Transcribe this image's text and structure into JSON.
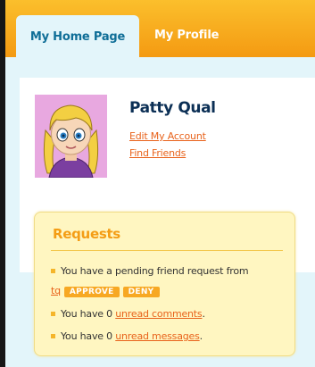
{
  "tabs": [
    {
      "label": "My Home Page",
      "active": true
    },
    {
      "label": "My Profile",
      "active": false
    }
  ],
  "user": {
    "name": "Patty Qual",
    "edit_account": "Edit My Account",
    "find_friends": "Find Friends"
  },
  "requests": {
    "title": "Requests",
    "friend_request_text": "You have a pending friend request from",
    "friend_name": "tq",
    "approve_label": "APPROVE",
    "deny_label": "DENY",
    "comments_prefix": "You have 0",
    "comments_link": "unread comments",
    "messages_prefix": "You have 0",
    "messages_link": "unread messages",
    "period": "."
  },
  "colors": {
    "tab_gradient_top": "#fbbf2c",
    "tab_gradient_bottom": "#f49a12",
    "active_tab_text": "#0f6e97",
    "link": "#e8621a",
    "name": "#0b2f55",
    "requests_bg": "#fff6c1",
    "requests_title": "#f49d15"
  }
}
